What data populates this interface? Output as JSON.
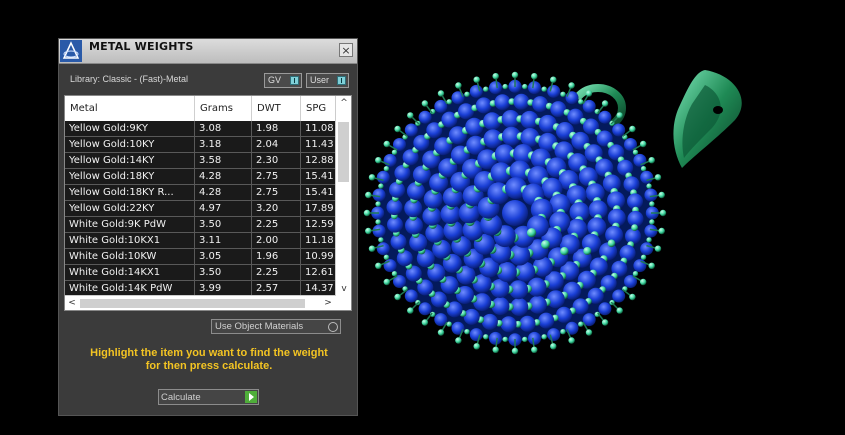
{
  "panel": {
    "title": "METAL WEIGHTS",
    "close_glyph": "×",
    "library_label": "Library: Classic - (Fast)-Metal",
    "toggles": [
      {
        "label": "GV",
        "checked": true
      },
      {
        "label": "User",
        "checked": true
      }
    ],
    "columns": [
      "Metal",
      "Grams",
      "DWT",
      "SPG"
    ],
    "rows": [
      [
        "Yellow Gold:9KY",
        "3.08",
        "1.98",
        "11.08"
      ],
      [
        "Yellow Gold:10KY",
        "3.18",
        "2.04",
        "11.43"
      ],
      [
        "Yellow Gold:14KY",
        "3.58",
        "2.30",
        "12.88"
      ],
      [
        "Yellow Gold:18KY",
        "4.28",
        "2.75",
        "15.41"
      ],
      [
        "Yellow Gold:18KY R...",
        "4.28",
        "2.75",
        "15.41"
      ],
      [
        "Yellow Gold:22KY",
        "4.97",
        "3.20",
        "17.89"
      ],
      [
        "White Gold:9K PdW",
        "3.50",
        "2.25",
        "12.59"
      ],
      [
        "White Gold:10KX1",
        "3.11",
        "2.00",
        "11.18"
      ],
      [
        "White Gold:10KW",
        "3.05",
        "1.96",
        "10.99"
      ],
      [
        "White Gold:14KX1",
        "3.50",
        "2.25",
        "12.61"
      ],
      [
        "White Gold:14K PdW",
        "3.99",
        "2.57",
        "14.37"
      ]
    ],
    "scroll_up_glyph": "^",
    "scroll_down_glyph": "v",
    "scroll_left_glyph": "<",
    "scroll_right_glyph": ">",
    "object_materials_label": "Use Object Materials",
    "hint_line1": "Highlight the item you want to find the weight",
    "hint_line2": "for then press calculate.",
    "calculate_label": "Calculate"
  },
  "colors": {
    "hint": "#f3c423",
    "gem_blue": "#1a3fd6",
    "prong_green": "#3fd6a0",
    "bail_green": "#1f8a55"
  },
  "icons": [
    "rhino-logo-icon",
    "close-icon",
    "checkbox-icon",
    "radio-icon",
    "play-arrow-icon"
  ]
}
